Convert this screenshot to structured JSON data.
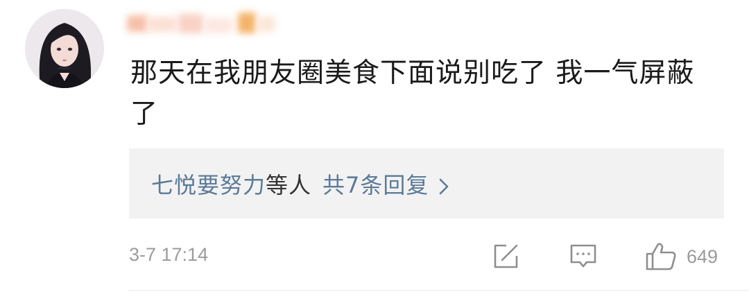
{
  "comment": {
    "text": "那天在我朋友圈美食下面说别吃了 我一气屏蔽了",
    "reply_names": "七悦要努力",
    "reply_suffix": "等人",
    "reply_count": "共7条回复",
    "timestamp": "3-7 17:14",
    "like_count": "649"
  },
  "icons": {
    "share": "share-icon",
    "comment": "comment-icon",
    "like": "thumbs-up-icon",
    "chevron": "chevron-right-icon"
  },
  "colors": {
    "link": "#5b7a98",
    "reply_bg": "#f2f2f2",
    "meta": "#9b9b9b",
    "text": "#1a1a1a"
  }
}
